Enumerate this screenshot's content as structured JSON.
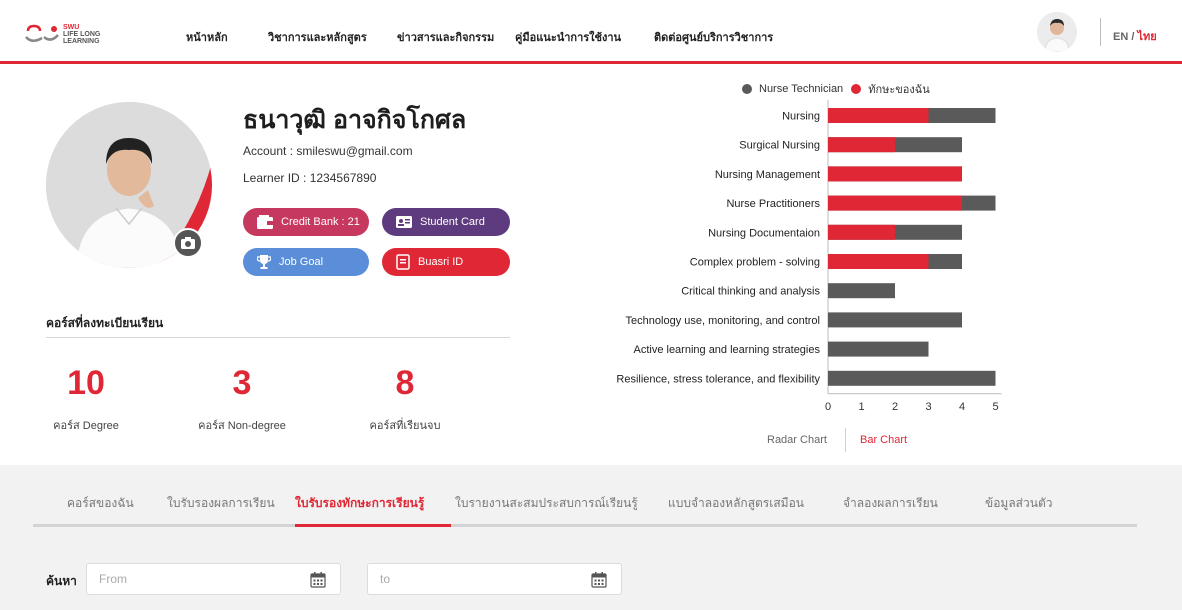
{
  "header": {
    "logo_text": [
      "SWU",
      "LIFE LONG",
      "LEARNING"
    ],
    "nav": [
      "หน้าหลัก",
      "วิชาการและหลักสูตร",
      "ข่าวสารและกิจกรรม",
      "คู่มือแนะนำการใช้งาน",
      "ติดต่อศูนย์บริการวิชาการ"
    ],
    "lang_en": "EN",
    "lang_sep": "/",
    "lang_th": "ไทย",
    "accent_color": "#e02735"
  },
  "profile": {
    "name": "ธนาวุฒิ อาจกิจโกศล",
    "account": "Account : smileswu@gmail.com",
    "learner_id": "Learner ID : 1234567890",
    "buttons": {
      "credit_bank": "Credit Bank : 21",
      "student_card": "Student Card",
      "job_goal": "Job Goal",
      "buasri_id": "Buasri ID"
    }
  },
  "courses": {
    "title": "คอร์สที่ลงทะเบียนเรียน",
    "stats": [
      {
        "value": "10",
        "label": "คอร์ส Degree"
      },
      {
        "value": "3",
        "label": "คอร์ส Non-degree"
      },
      {
        "value": "8",
        "label": "คอร์สที่เรียนจบ"
      }
    ]
  },
  "chart_data": {
    "type": "bar",
    "orientation": "horizontal",
    "categories": [
      "Nursing",
      "Surgical Nursing",
      "Nursing Management",
      "Nurse Practitioners",
      "Nursing Documentaion",
      "Complex problem - solving",
      "Critical thinking and analysis",
      "Technology use, monitoring, and control",
      "Active learning and learning strategies",
      "Resilience, stress tolerance, and flexibility"
    ],
    "series": [
      {
        "name": "Nurse Technician",
        "color": "#5a5a5a",
        "values": [
          5,
          4,
          4,
          5,
          4,
          4,
          2,
          4,
          3,
          5
        ]
      },
      {
        "name": "ทักษะของฉัน",
        "color": "#e02735",
        "values": [
          3,
          2,
          4,
          4,
          2,
          3,
          0,
          0,
          0,
          0
        ]
      }
    ],
    "xlim": [
      0,
      5
    ],
    "xticks": [
      "0",
      "1",
      "2",
      "3",
      "4",
      "5"
    ],
    "legend_position": "top"
  },
  "chart_tabs": {
    "radar": "Radar Chart",
    "bar": "Bar Chart"
  },
  "tabs": [
    "คอร์สของฉัน",
    "ใบรับรองผลการเรียน",
    "ใบรับรองทักษะการเรียนรู้",
    "ใบรายงานสะสมประสบการณ์เรียนรู้",
    "แบบจำลองหลักสูตรเสมือน",
    "จำลองผลการเรียน",
    "ข้อมูลส่วนตัว"
  ],
  "active_tab": "ใบรับรองทักษะการเรียนรู้",
  "search": {
    "label": "ค้นหา",
    "from_placeholder": "From",
    "to_placeholder": "to"
  }
}
